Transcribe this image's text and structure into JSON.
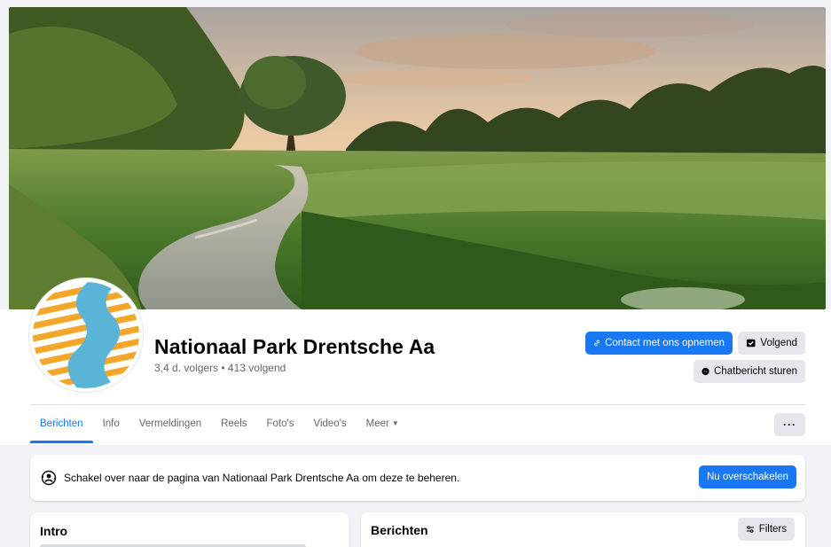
{
  "page": {
    "name": "Nationaal Park Drentsche Aa",
    "stats": "3,4 d. volgers • 413 volgend"
  },
  "actions": {
    "contact_label": "Contact met ons opnemen",
    "follow_label": "Volgend",
    "chat_label": "Chatbericht sturen",
    "more_label": "···"
  },
  "tabs": [
    {
      "label": "Berichten",
      "active": true
    },
    {
      "label": "Info"
    },
    {
      "label": "Vermeldingen"
    },
    {
      "label": "Reels"
    },
    {
      "label": "Foto's"
    },
    {
      "label": "Video's"
    },
    {
      "label": "Meer"
    }
  ],
  "switch_banner": {
    "text": "Schakel over naar de pagina van Nationaal Park Drentsche Aa om deze te beheren.",
    "button_label": "Nu overschakelen"
  },
  "intro": {
    "title": "Intro"
  },
  "posts": {
    "title": "Berichten",
    "filters_label": "Filters"
  },
  "icons": {
    "contact": "link-icon",
    "follow": "follow-check-icon",
    "chat": "messenger-icon",
    "switch": "profile-switch-icon",
    "filters": "sliders-icon"
  },
  "colors": {
    "primary": "#1877f2",
    "secondary_button": "#e4e6eb",
    "muted_text": "#65676b",
    "logo_orange": "#f4a62a",
    "logo_blue": "#5ab4d6"
  }
}
